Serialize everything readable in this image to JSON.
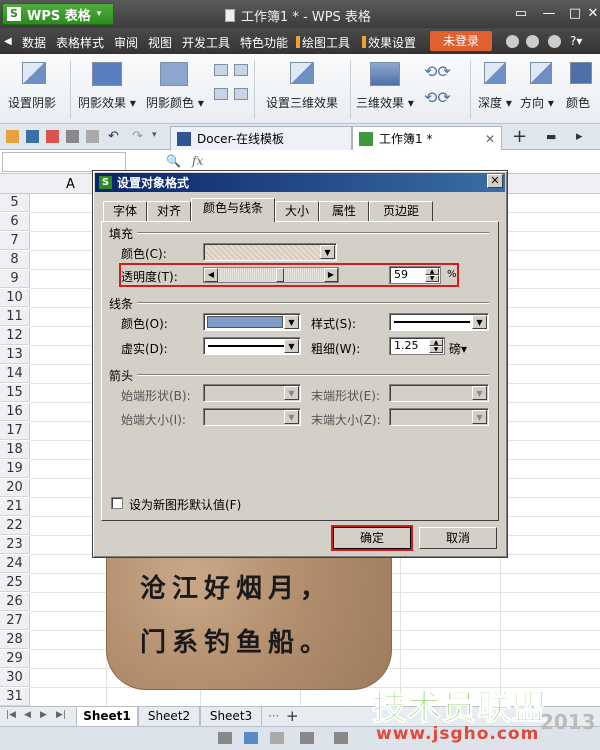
{
  "app": {
    "name": "WPS 表格",
    "doc_title": "工作簿1 * - WPS 表格"
  },
  "menu": [
    "数据",
    "表格样式",
    "审阅",
    "视图",
    "开发工具",
    "特色功能",
    "绘图工具",
    "效果设置"
  ],
  "login_label": "未登录",
  "ribbon": {
    "shadow_settings": "设置阴影",
    "shadow_effect": "阴影效果 ▾",
    "shadow_color": "阴影颜色 ▾",
    "settings_3d": "设置三维效果",
    "effect_3d": "三维效果 ▾",
    "depth": "深度 ▾",
    "direction": "方向 ▾",
    "color": "颜色"
  },
  "tabs": {
    "docer": "Docer-在线模板",
    "workbook": "工作簿1 *",
    "add": "+"
  },
  "formula": {
    "fx": "fx"
  },
  "sheet": {
    "col_a": "A",
    "rows": [
      "5",
      "6",
      "7",
      "8",
      "9",
      "10",
      "11",
      "12",
      "13",
      "14",
      "15",
      "16",
      "17",
      "18",
      "19",
      "20",
      "21",
      "22",
      "23",
      "24",
      "25",
      "26",
      "27",
      "28",
      "29",
      "30",
      "31"
    ],
    "poem_line1": "沧江好烟月，",
    "poem_line2": "门系钓鱼船。"
  },
  "sheet_tabs": [
    "Sheet1",
    "Sheet2",
    "Sheet3"
  ],
  "dialog": {
    "title": "设置对象格式",
    "tabs": [
      "字体",
      "对齐",
      "颜色与线条",
      "大小",
      "属性",
      "页边距"
    ],
    "fill_section": "填充",
    "fill_color_label": "颜色(C):",
    "transparency_label": "透明度(T):",
    "transparency_value": "59",
    "transparency_unit": "%",
    "line_section": "线条",
    "line_color_label": "颜色(O):",
    "line_style_label": "样式(S):",
    "dash_label": "虚实(D):",
    "weight_label": "粗细(W):",
    "weight_value": "1.25",
    "weight_unit": "磅▾",
    "arrow_section": "箭头",
    "begin_style_label": "始端形状(B):",
    "end_style_label": "末端形状(E):",
    "begin_size_label": "始端大小(I):",
    "end_size_label": "末端大小(Z):",
    "default_checkbox": "设为新图形默认值(F)",
    "ok": "确定",
    "cancel": "取消",
    "line_color_hex": "#7f9cc8"
  },
  "watermark": {
    "big": "技术员联盟",
    "url": "www.jsgho.com",
    "year": "2013"
  }
}
